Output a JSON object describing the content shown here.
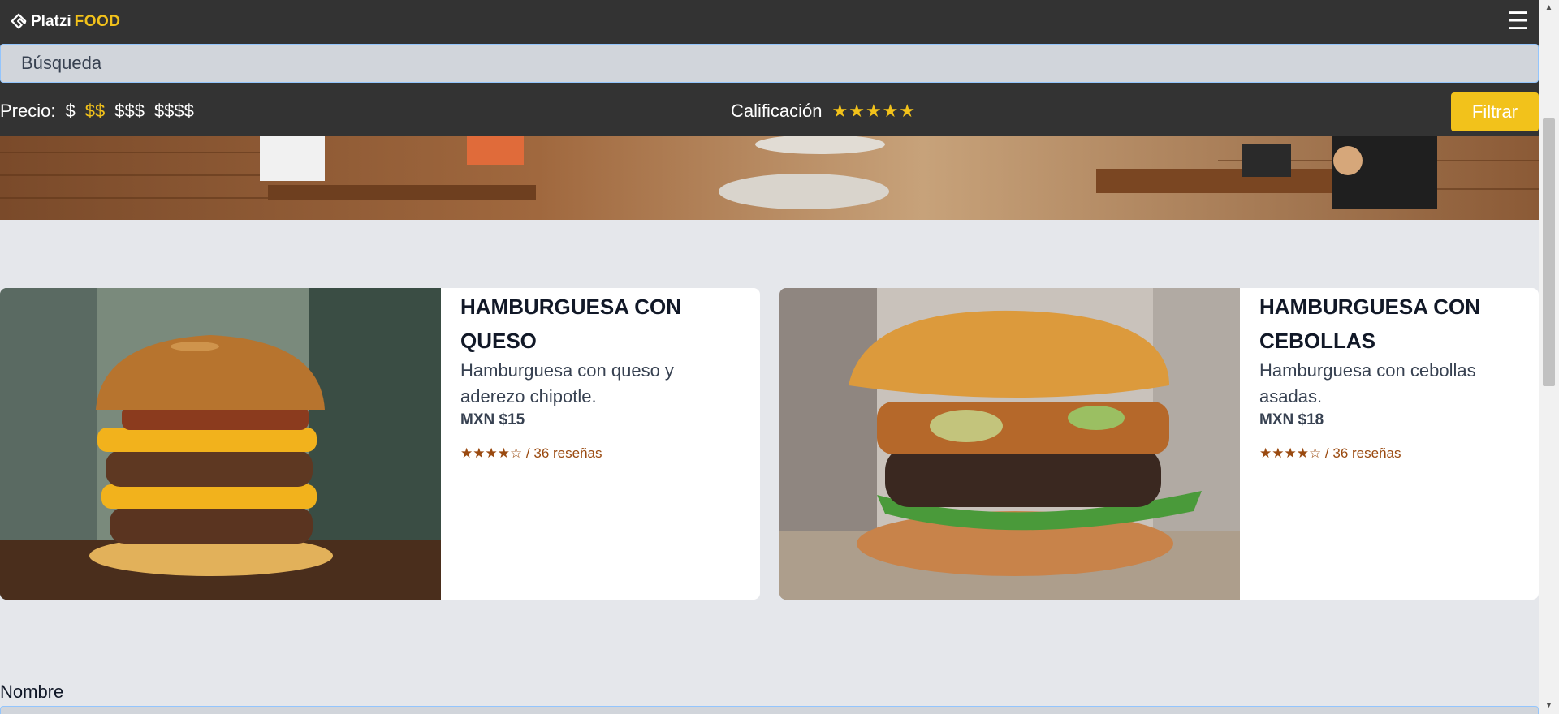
{
  "header": {
    "brand": "Platzi",
    "brand_accent": "FOOD",
    "menu_icon": "hamburger-menu-icon"
  },
  "search": {
    "placeholder": "Búsqueda"
  },
  "filters": {
    "price_label": "Precio:",
    "price_options": [
      "$",
      "$$",
      "$$$",
      "$$$$"
    ],
    "price_selected": "$$",
    "rating_label": "Calificación",
    "rating_stars": "★★★★★",
    "filter_button": "Filtrar"
  },
  "colors": {
    "accent": "#f2c21b",
    "dark_bar": "#333333",
    "page_bg": "#e5e7eb",
    "rating_text": "#9a4a10"
  },
  "products": [
    {
      "title": "HAMBURGUESA CON QUESO",
      "description": "Hamburguesa con queso y aderezo chipotle.",
      "price": "MXN $15",
      "rating": "★★★★☆ / 36 reseñas"
    },
    {
      "title": "HAMBURGUESA CON CEBOLLAS",
      "description": "Hamburguesa con cebollas asadas.",
      "price": "MXN $18",
      "rating": "★★★★☆ / 36 reseñas"
    }
  ],
  "form": {
    "name_label": "Nombre"
  }
}
